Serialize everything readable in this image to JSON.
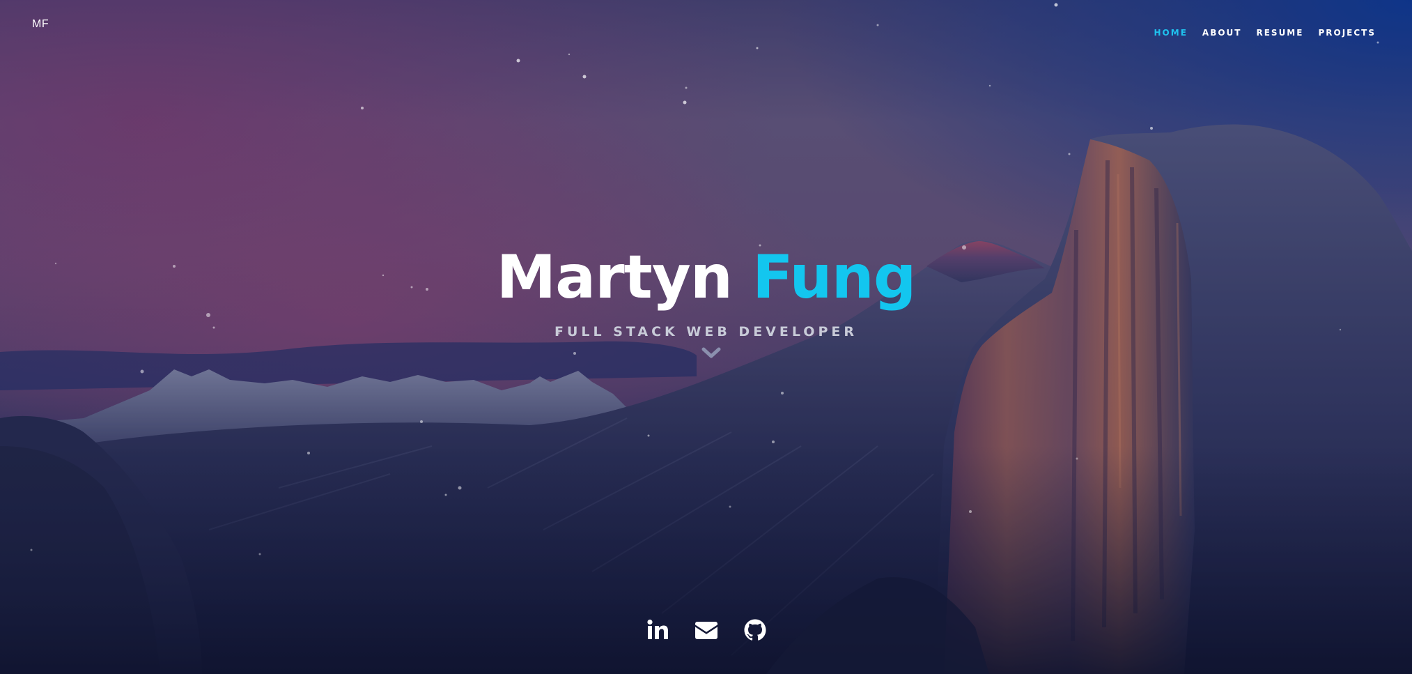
{
  "site": {
    "logo_text": "MF"
  },
  "nav": {
    "items": [
      {
        "label": "HOME",
        "active": true
      },
      {
        "label": "ABOUT",
        "active": false
      },
      {
        "label": "RESUME",
        "active": false
      },
      {
        "label": "PROJECTS",
        "active": false
      }
    ]
  },
  "hero": {
    "first_name": "Martyn",
    "last_name": "Fung",
    "subtitle": "FULL STACK WEB DEVELOPER",
    "scroll_icon": "chevron-down-icon"
  },
  "social": [
    {
      "icon": "linkedin-icon"
    },
    {
      "icon": "envelope-icon"
    },
    {
      "icon": "github-icon"
    }
  ],
  "colors": {
    "accent": "#13c6ef",
    "text": "#ffffff",
    "subtitle": "#c8cbd8"
  }
}
